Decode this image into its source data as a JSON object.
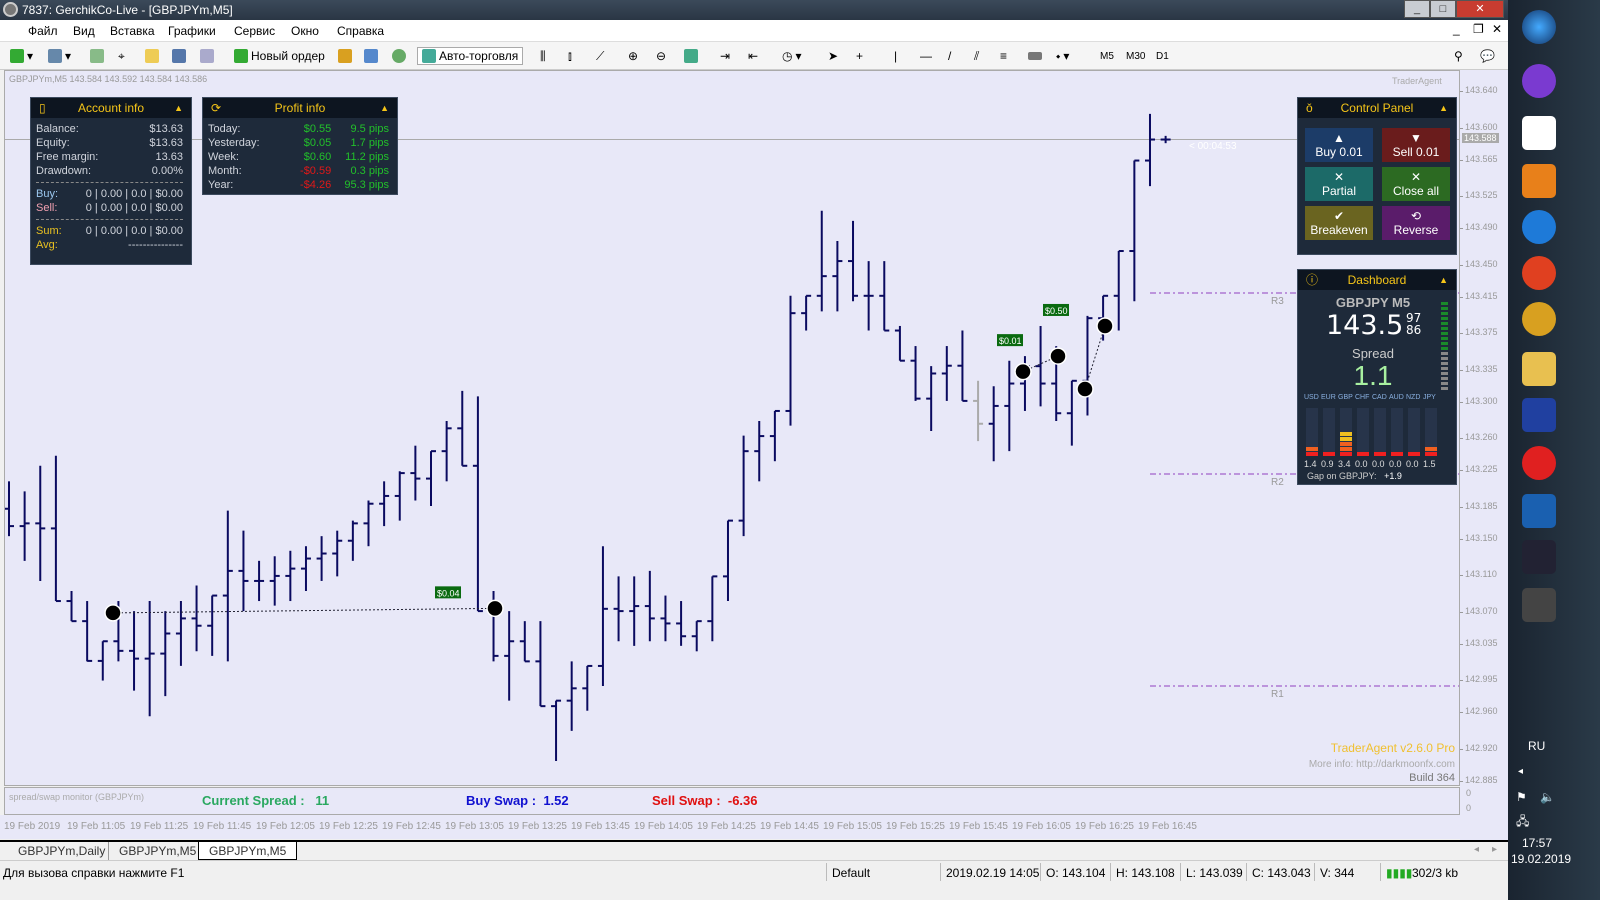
{
  "window": {
    "title": "7837: GerchikCo-Live - [GBPJPYm,M5]"
  },
  "menu": [
    "Файл",
    "Вид",
    "Вставка",
    "Графики",
    "Сервис",
    "Окно",
    "Справка"
  ],
  "toolbar": {
    "new_order": "Новый ордер",
    "autotrading": "Авто-торговля",
    "timeframes": [
      "M5",
      "M30",
      "D1"
    ]
  },
  "chart": {
    "header": "GBPJPYm,M5  143.584 143.592 143.584 143.586",
    "brand": "TraderAgent",
    "timer": "< 00:04:53",
    "current_price": "143.588",
    "price_labels": [
      "143.640",
      "143.600",
      "143.565",
      "143.525",
      "143.490",
      "143.450",
      "143.415",
      "143.375",
      "143.335",
      "143.300",
      "143.260",
      "143.225",
      "143.185",
      "143.150",
      "143.110",
      "143.070",
      "143.035",
      "142.995",
      "142.960",
      "142.920",
      "142.885"
    ],
    "price_range": [
      142.885,
      143.64
    ],
    "levels": [
      {
        "name": "R3",
        "price": 143.42
      },
      {
        "name": "R2",
        "price": 143.222
      },
      {
        "name": "R1",
        "price": 142.99
      }
    ],
    "trade_labels": [
      "$0.04",
      "$0.01",
      "$0.50"
    ],
    "bar_color": "#0a0a60",
    "bars": [
      [
        143.214,
        143.154
      ],
      [
        143.203,
        143.127
      ],
      [
        143.231,
        143.105
      ],
      [
        143.242,
        143.083
      ],
      [
        143.094,
        143.061
      ],
      [
        143.083,
        143.017
      ],
      [
        143.039,
        142.996
      ],
      [
        143.083,
        143.017
      ],
      [
        143.072,
        142.985
      ],
      [
        143.083,
        142.957
      ],
      [
        143.072,
        142.979
      ],
      [
        143.083,
        143.012
      ],
      [
        143.1,
        143.028
      ],
      [
        143.089,
        143.023
      ],
      [
        143.182,
        143.017
      ],
      [
        143.16,
        143.072
      ],
      [
        143.127,
        143.083
      ],
      [
        143.132,
        143.078
      ],
      [
        143.138,
        143.083
      ],
      [
        143.143,
        143.094
      ],
      [
        143.154,
        143.105
      ],
      [
        143.16,
        143.11
      ],
      [
        143.171,
        143.127
      ],
      [
        143.193,
        143.143
      ],
      [
        143.214,
        143.165
      ],
      [
        143.225,
        143.171
      ],
      [
        143.253,
        143.193
      ],
      [
        143.247,
        143.187
      ],
      [
        143.28,
        143.214
      ],
      [
        143.313,
        143.231
      ],
      [
        143.307,
        143.072
      ],
      [
        143.094,
        143.017
      ],
      [
        143.072,
        142.974
      ],
      [
        143.061,
        143.017
      ],
      [
        143.061,
        142.968
      ],
      [
        142.974,
        142.908
      ],
      [
        143.017,
        142.941
      ],
      [
        143.012,
        142.963
      ],
      [
        143.143,
        142.99
      ],
      [
        143.11,
        143.039
      ],
      [
        143.11,
        143.034
      ],
      [
        143.116,
        143.039
      ],
      [
        143.089,
        143.039
      ],
      [
        143.083,
        143.034
      ],
      [
        143.061,
        143.028
      ],
      [
        143.11,
        143.039
      ],
      [
        143.171,
        143.083
      ],
      [
        143.264,
        143.154
      ],
      [
        143.28,
        143.214
      ],
      [
        143.291,
        143.236
      ],
      [
        143.417,
        143.275
      ],
      [
        143.417,
        143.379
      ],
      [
        143.51,
        143.4
      ],
      [
        143.477,
        143.4
      ],
      [
        143.499,
        143.411
      ],
      [
        143.455,
        143.379
      ],
      [
        143.455,
        143.379
      ],
      [
        143.384,
        143.346
      ],
      [
        143.362,
        143.302
      ],
      [
        143.34,
        143.269
      ],
      [
        143.362,
        143.302
      ],
      [
        143.379,
        143.302
      ],
      [
        143.324,
        143.258
      ],
      [
        143.318,
        143.236
      ],
      [
        143.346,
        143.247
      ],
      [
        143.351,
        143.291
      ],
      [
        143.384,
        143.296
      ],
      [
        143.362,
        143.28
      ],
      [
        143.324,
        143.253
      ],
      [
        143.395,
        143.286
      ],
      [
        143.417,
        143.368
      ],
      [
        143.466,
        143.379
      ],
      [
        143.565,
        143.411
      ],
      [
        143.616,
        143.537
      ],
      [
        143.592,
        143.584
      ]
    ],
    "footer": {
      "version": "TraderAgent v2.6.0 Pro",
      "more_info": "More info: http://darkmoonfx.com",
      "build": "Build 364"
    }
  },
  "account_info": {
    "title": "Account info",
    "rows": [
      [
        "Balance:",
        "$13.63"
      ],
      [
        "Equity:",
        "$13.63"
      ],
      [
        "Free margin:",
        "13.63"
      ],
      [
        "Drawdown:",
        "0.00%"
      ]
    ],
    "buy": [
      "Buy:",
      "0 | 0.00 | 0.0 | $0.00"
    ],
    "sell": [
      "Sell:",
      "0 | 0.00 | 0.0 | $0.00"
    ],
    "sum": [
      "Sum:",
      "0 | 0.00 | 0.0 | $0.00"
    ],
    "avg": [
      "Avg:",
      "---------------"
    ]
  },
  "profit_info": {
    "title": "Profit info",
    "rows": [
      {
        "label": "Today:",
        "money": "$0.55",
        "pips": "9.5 pips",
        "neg": false
      },
      {
        "label": "Yesterday:",
        "money": "$0.05",
        "pips": "1.7 pips",
        "neg": false
      },
      {
        "label": "Week:",
        "money": "$0.60",
        "pips": "11.2 pips",
        "neg": false
      },
      {
        "label": "Month:",
        "money": "-$0.59",
        "pips": "0.3 pips",
        "neg": true
      },
      {
        "label": "Year:",
        "money": "-$4.26",
        "pips": "95.3 pips",
        "neg": true
      }
    ]
  },
  "control_panel": {
    "title": "Control Panel",
    "buy": "Buy 0.01",
    "sell": "Sell 0.01",
    "partial": "Partial",
    "close_all": "Close all",
    "breakeven": "Breakeven",
    "reverse": "Reverse"
  },
  "dashboard": {
    "title": "Dashboard",
    "symbol": "GBPJPY M5",
    "price_main": "143.5",
    "price_sup": "97",
    "price_sub": "86",
    "spread_label": "Spread",
    "spread": "1.1",
    "currencies": [
      "USD",
      "EUR",
      "GBP",
      "CHF",
      "CAD",
      "AUD",
      "NZD",
      "JPY"
    ],
    "strength": [
      "1.4",
      "0.9",
      "3.4",
      "0.0",
      "0.0",
      "0.0",
      "0.0",
      "1.5"
    ],
    "gap_label": "Gap on GBPJPY:",
    "gap": "+1.9"
  },
  "monitor": {
    "title": "spread/swap monitor (GBPJPYm)",
    "spread_label": "Current Spread :",
    "spread": "11",
    "buy_swap_label": "Buy Swap :",
    "buy_swap": "1.52",
    "sell_swap_label": "Sell Swap :",
    "sell_swap": "-6.36",
    "axis": [
      "0",
      "0"
    ]
  },
  "time_labels": [
    "19 Feb 2019",
    "19 Feb 11:05",
    "19 Feb 11:25",
    "19 Feb 11:45",
    "19 Feb 12:05",
    "19 Feb 12:25",
    "19 Feb 12:45",
    "19 Feb 13:05",
    "19 Feb 13:25",
    "19 Feb 13:45",
    "19 Feb 14:05",
    "19 Feb 14:25",
    "19 Feb 14:45",
    "19 Feb 15:05",
    "19 Feb 15:25",
    "19 Feb 15:45",
    "19 Feb 16:05",
    "19 Feb 16:25",
    "19 Feb 16:45"
  ],
  "tabs": [
    "GBPJPYm,Daily",
    "GBPJPYm,M5",
    "GBPJPYm,M5"
  ],
  "status": {
    "help": "Для вызова справки нажмите F1",
    "profile": "Default",
    "time": "2019.02.19 14:05",
    "open": "O: 143.104",
    "high": "H: 143.108",
    "low": "L: 143.039",
    "close": "C: 143.043",
    "volume": "V: 344",
    "traffic": "302/3 kb"
  },
  "taskbar": {
    "lang": "RU",
    "clock": "17:57",
    "date": "19.02.2019"
  }
}
